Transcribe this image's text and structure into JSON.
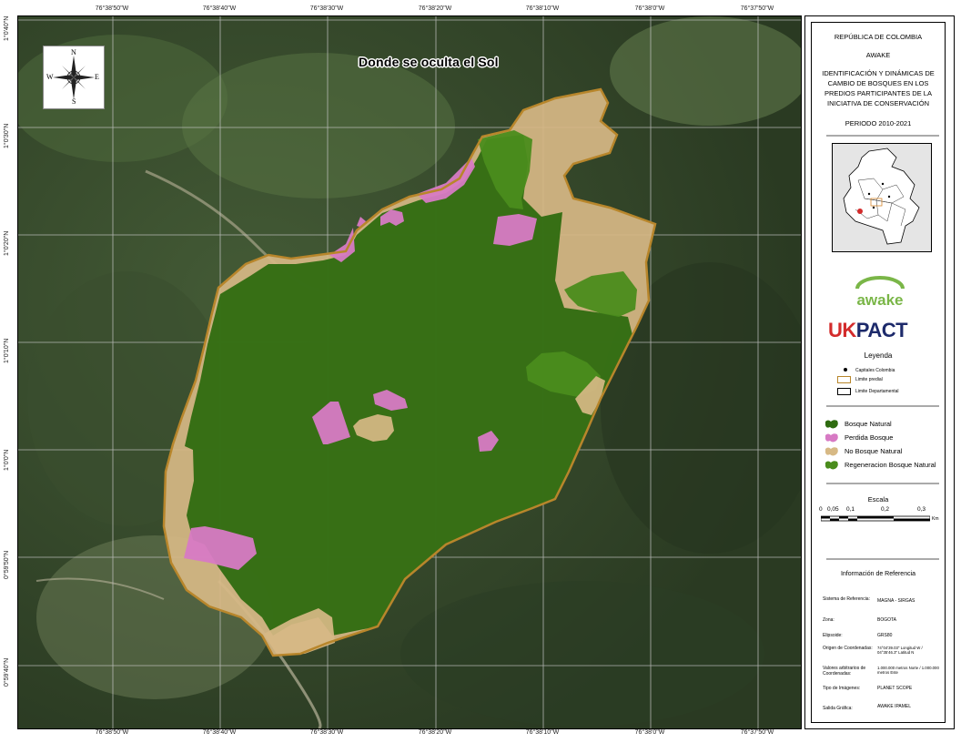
{
  "map": {
    "title": "Donde se oculta el Sol",
    "top_coords": [
      "76°38'50\"W",
      "76°38'40\"W",
      "76°38'30\"W",
      "76°38'20\"W",
      "76°38'10\"W",
      "76°38'0\"W",
      "76°37'50\"W"
    ],
    "bottom_coords": [
      "76°38'50\"W",
      "76°38'40\"W",
      "76°38'30\"W",
      "76°38'20\"W",
      "76°38'10\"W",
      "76°38'0\"W",
      "76°37'50\"W"
    ],
    "left_coords": [
      "1°0'40\"N",
      "1°0'30\"N",
      "1°0'20\"N",
      "1°0'10\"N",
      "1°0'0\"N",
      "0°59'50\"N",
      "0°59'40\"N"
    ],
    "compass": {
      "n": "N",
      "s": "S",
      "e": "E",
      "w": "W"
    },
    "colors": {
      "bosque_natural": "#2e6b10",
      "perdida_bosque": "#d77ac4",
      "no_bosque_natural": "#d7b985",
      "regeneracion": "#4a8c1c",
      "limite_predial": "#b8862b"
    }
  },
  "panel": {
    "country": "REPÚBLICA DE COLOMBIA",
    "org": "AWAKE",
    "study_title": [
      "IDENTIFICACIÓN Y DINÁMICAS DE",
      "CAMBIO DE BOSQUES EN LOS",
      "PREDIOS PARTICIPANTES DE LA",
      "INICIATIVA DE CONSERVACIÓN"
    ],
    "period": "PERIODO 2010-2021",
    "logo_awake": "awake",
    "logo_uk": "UK",
    "logo_pact": "PACT",
    "legend_title": "Leyenda",
    "legend_small": [
      "Capitales Colombia",
      "Limite predial",
      "Limite Departamental"
    ],
    "legend_items": [
      "Bosque Natural",
      "Perdida Bosque",
      "No Bosque Natural",
      "Regeneracion Bosque Natural"
    ],
    "scale_title": "Escala",
    "scale_labels": [
      "0",
      "0,05",
      "0,1",
      "0,2",
      "0,3"
    ],
    "scale_unit": "Km",
    "ref_title": "Información de Referencia",
    "ref_rows": [
      {
        "label": "Sistema de Referencia:",
        "value": "MAGNA - SIRGAS"
      },
      {
        "label": "Zona:",
        "value": "BOGOTA"
      },
      {
        "label": "Elipsoide:",
        "value": "GRS80"
      },
      {
        "label": "Origen de Coordenadas:",
        "value": "74°04'39.03\" Longitud W / 04°35'46.3\" Latitud N"
      },
      {
        "label": "Valores arbitrarios de Coordenadas:",
        "value": "1.000.000 metros Norte / 1.000.000 metros Este"
      },
      {
        "label": "Tipo de Imágenes:",
        "value": "PLANET SCOPE"
      },
      {
        "label": "Salida Gráfica:",
        "value": "AWAKE IPAMEL"
      }
    ]
  }
}
